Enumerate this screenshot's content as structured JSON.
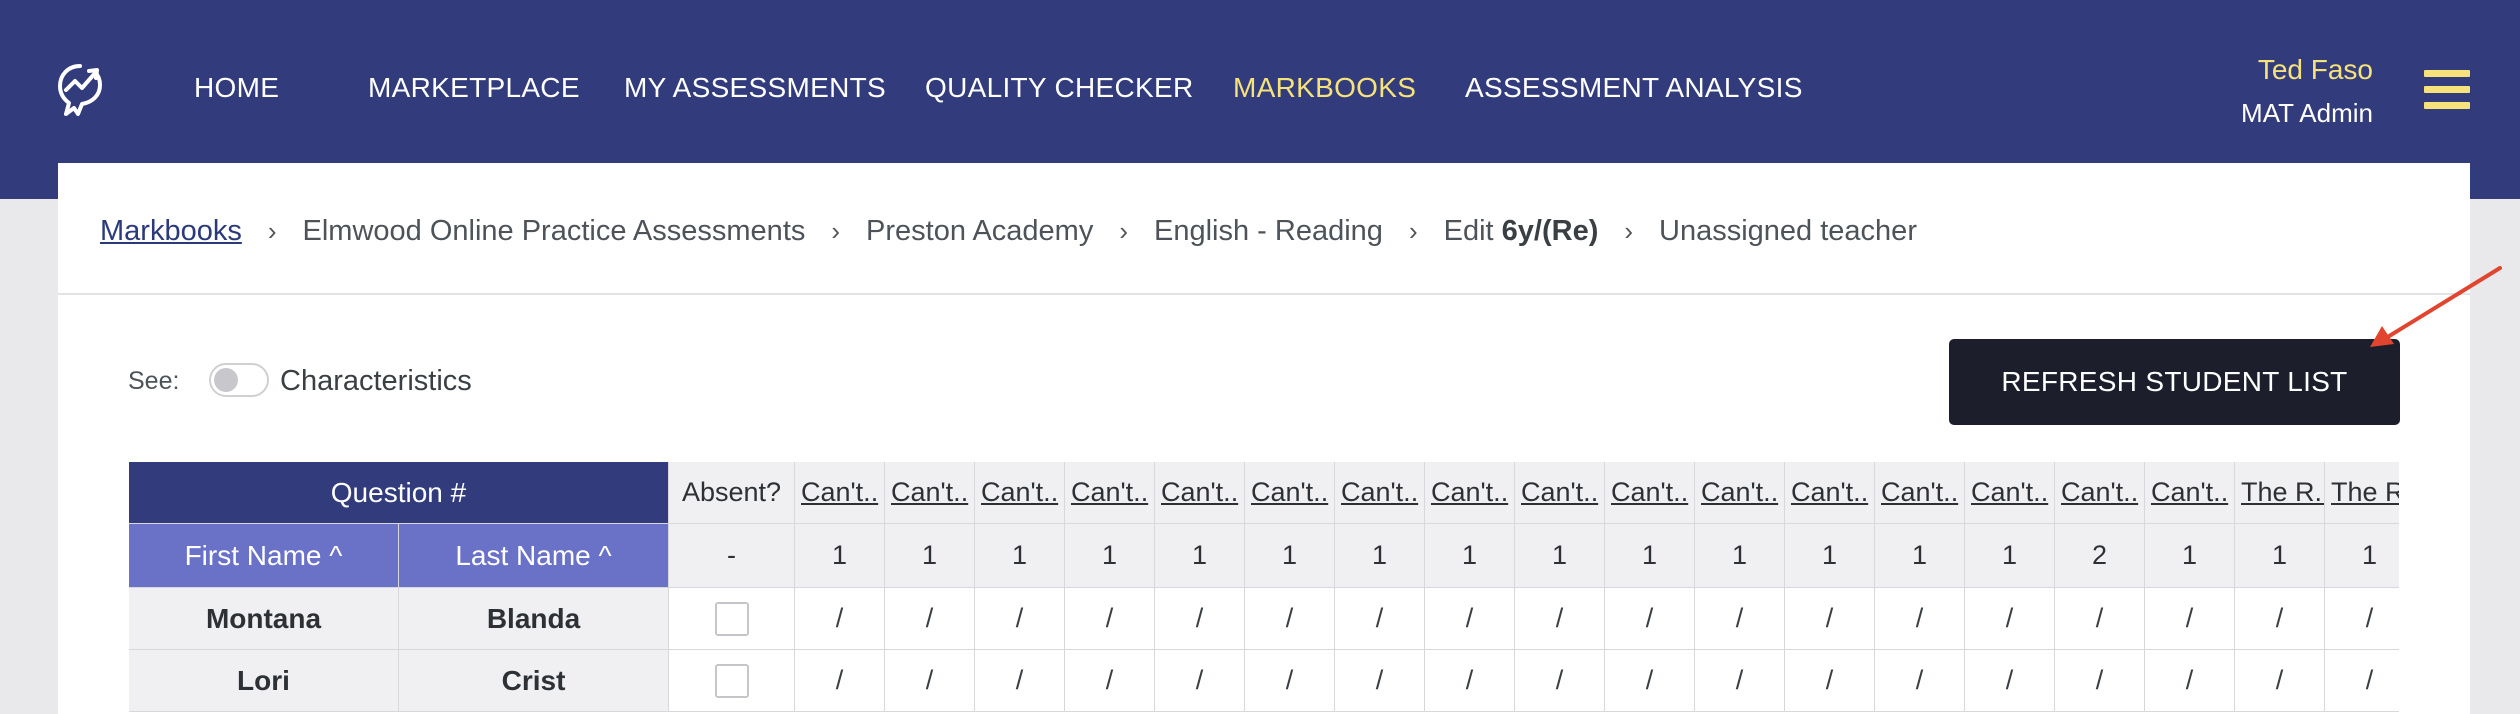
{
  "nav": {
    "items": [
      {
        "label": "HOME",
        "active": false
      },
      {
        "label": "MARKETPLACE",
        "active": false
      },
      {
        "label": "MY ASSESSMENTS",
        "active": false
      },
      {
        "label": "QUALITY CHECKER",
        "active": false
      },
      {
        "label": "MARKBOOKS",
        "active": true
      },
      {
        "label": "ASSESSMENT ANALYSIS",
        "active": false
      }
    ],
    "logo_icon": "growth-chart-logo-icon",
    "menu_icon": "hamburger-menu-icon"
  },
  "user": {
    "name": "Ted Faso",
    "role": "MAT Admin"
  },
  "breadcrumb": {
    "markbooks": "Markbooks",
    "trust": "Elmwood Online Practice Assessments",
    "school": "Preston Academy",
    "subject": "English - Reading",
    "edit_prefix": "Edit",
    "class_name": "6y/(Re)",
    "teacher": "Unassigned teacher",
    "separator": "›"
  },
  "filters": {
    "see_label": "See:",
    "toggle_label": "Characteristics",
    "toggle_on": false
  },
  "toolbar": {
    "refresh_label": "REFRESH STUDENT LIST"
  },
  "table": {
    "question_header": "Question #",
    "first_name_header": "First Name ^",
    "last_name_header": "Last Name ^",
    "absent_header": "Absent?",
    "absent_marks_value": "-",
    "questions": [
      {
        "label": "Can't..",
        "marks": "1"
      },
      {
        "label": "Can't..",
        "marks": "1"
      },
      {
        "label": "Can't..",
        "marks": "1"
      },
      {
        "label": "Can't..",
        "marks": "1"
      },
      {
        "label": "Can't..",
        "marks": "1"
      },
      {
        "label": "Can't..",
        "marks": "1"
      },
      {
        "label": "Can't..",
        "marks": "1"
      },
      {
        "label": "Can't..",
        "marks": "1"
      },
      {
        "label": "Can't..",
        "marks": "1"
      },
      {
        "label": "Can't..",
        "marks": "1"
      },
      {
        "label": "Can't..",
        "marks": "1"
      },
      {
        "label": "Can't..",
        "marks": "1"
      },
      {
        "label": "Can't..",
        "marks": "1"
      },
      {
        "label": "Can't..",
        "marks": "1"
      },
      {
        "label": "Can't..",
        "marks": "2"
      },
      {
        "label": "Can't..",
        "marks": "1"
      },
      {
        "label": "The R..",
        "marks": "1"
      },
      {
        "label": "The R..",
        "marks": "1"
      }
    ],
    "students": [
      {
        "first": "Montana",
        "last": "Blanda",
        "absent": false,
        "entries": [
          "/",
          "/",
          "/",
          "/",
          "/",
          "/",
          "/",
          "/",
          "/",
          "/",
          "/",
          "/",
          "/",
          "/",
          "/",
          "/",
          "/",
          "/"
        ]
      },
      {
        "first": "Lori",
        "last": "Crist",
        "absent": false,
        "entries": [
          "/",
          "/",
          "/",
          "/",
          "/",
          "/",
          "/",
          "/",
          "/",
          "/",
          "/",
          "/",
          "/",
          "/",
          "/",
          "/",
          "/",
          "/"
        ]
      }
    ]
  },
  "colors": {
    "nav_bg": "#323c7c",
    "nav_active": "#f5e27a",
    "header_light": "#6a72c8",
    "button_bg": "#1c1f2b",
    "annotation_arrow": "#e2452f"
  }
}
